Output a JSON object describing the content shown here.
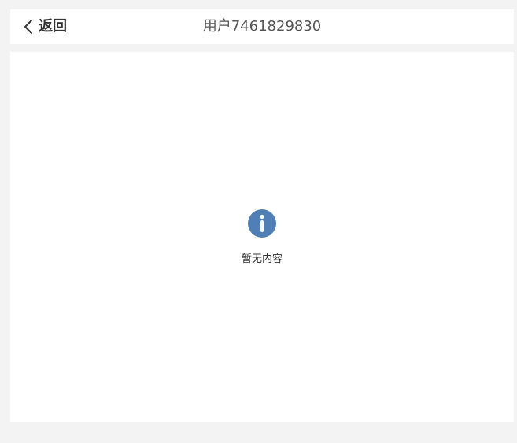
{
  "header": {
    "back_label": "返回",
    "title": "用户7461829830"
  },
  "empty_state": {
    "message": "暂无内容",
    "icon": "info-icon"
  },
  "colors": {
    "page_background": "#f3f3f3",
    "panel_background": "#ffffff",
    "info_icon": "#4f7fb4",
    "text": "#333333"
  }
}
